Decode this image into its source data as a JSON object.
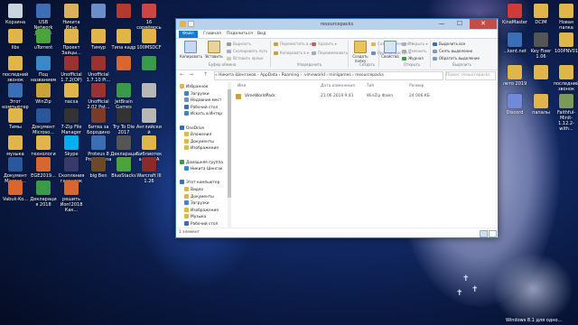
{
  "desktop": {
    "icons": [
      {
        "label": "Корзина",
        "color": "#c9d3dd"
      },
      {
        "label": "USB Network Joystick",
        "color": "#3e6cb5"
      },
      {
        "label": "Никита Илье",
        "color": "#d9b25a"
      },
      {
        "label": "",
        "color": "#6b8fc9"
      },
      {
        "label": "",
        "color": "#b23a2e"
      },
      {
        "label": "16 сорвёмось",
        "color": "#c44"
      },
      {
        "label": "libs",
        "color": "#e0b54a"
      },
      {
        "label": "uTorrent",
        "color": "#4aa33b"
      },
      {
        "label": "Проект Зайцы...",
        "color": "#e0b54a"
      },
      {
        "label": "Тимур",
        "color": "#e0b54a"
      },
      {
        "label": "Типа кадр",
        "color": "#e0b54a"
      },
      {
        "label": "100MSDCF",
        "color": "#e0b54a"
      },
      {
        "label": "последний звонок",
        "color": "#e0b54a"
      },
      {
        "label": "Под названием",
        "color": "#3a88c8"
      },
      {
        "label": "Unofficial 1.7.2(OP)",
        "color": "#9b3232"
      },
      {
        "label": "Unofficial 1.7.10 Pi...",
        "color": "#9b3232"
      },
      {
        "label": "",
        "color": "#d9662e"
      },
      {
        "label": "",
        "color": "#3a9a4a"
      },
      {
        "label": "Этот компьютер",
        "color": "#3a6fb5"
      },
      {
        "label": "WinZip",
        "color": "#c9a33a"
      },
      {
        "label": "пасха",
        "color": "#e0b54a"
      },
      {
        "label": "Unofficial 2.02 Pat...",
        "color": "#9b3232"
      },
      {
        "label": "JetBrain Games",
        "color": "#3a9a4a"
      },
      {
        "label": "",
        "color": "#b7b7b7"
      },
      {
        "label": "Тимы",
        "color": "#e0b54a"
      },
      {
        "label": "Документ Microso...",
        "color": "#2b579a"
      },
      {
        "label": "7-Zip File Manager",
        "color": "#333333"
      },
      {
        "label": "Битва за Бородино",
        "color": "#7a3b2a"
      },
      {
        "label": "Try To Die 2017",
        "color": "#333"
      },
      {
        "label": "Английский",
        "color": "#b7b7b7"
      },
      {
        "label": "музыка",
        "color": "#e0b54a"
      },
      {
        "label": "технология",
        "color": "#e0b54a"
      },
      {
        "label": "Skype",
        "color": "#00aff0"
      },
      {
        "label": "Proteus 8 Professional",
        "color": "#3a6fb5"
      },
      {
        "label": "Декларация 2017",
        "color": "#555"
      },
      {
        "label": "Библиотека АКОЛА",
        "color": "#e0b54a"
      },
      {
        "label": "Документ Microso...",
        "color": "#2b579a"
      },
      {
        "label": "ЕGE2019...",
        "color": "#d9662e"
      },
      {
        "label": "Скопления галактик",
        "color": "#3a3a6a"
      },
      {
        "label": "big Ben",
        "color": "#6a4a2a"
      },
      {
        "label": "BlueStacks",
        "color": "#4aa33b"
      },
      {
        "label": "Warcraft III 1.26",
        "color": "#8a2a2a"
      },
      {
        "label": "Vabuk-Ko...",
        "color": "#d9662e"
      },
      {
        "label": "Декларация 2018",
        "color": "#3a9a4a"
      },
      {
        "label": "решить Иоп!2018 Как...",
        "color": "#d9662e"
      }
    ],
    "right_icons": [
      {
        "label": "KineMaster",
        "color": "#d23a3a"
      },
      {
        "label": "DCIM",
        "color": "#e0b54a"
      },
      {
        "label": "Новая папка",
        "color": "#e0b54a"
      },
      {
        "label": "...kent.net",
        "color": "#3a6fb5"
      },
      {
        "label": "Key Fixer 1.06",
        "color": "#555"
      },
      {
        "label": "100PNV01",
        "color": "#e0b54a"
      },
      {
        "label": "лето 2019",
        "color": "#e0b54a"
      },
      {
        "label": "",
        "color": "#e0b54a"
      },
      {
        "label": "последний звонок",
        "color": "#e0b54a"
      },
      {
        "label": "Discord",
        "color": "#7289da"
      },
      {
        "label": "папалы",
        "color": "#e0b54a"
      },
      {
        "label": "Faithful-Minit-1.12.2-with...",
        "color": "#7a9a5a"
      }
    ],
    "taskbar_hint": "Windows 8.1 для одно..."
  },
  "window": {
    "title": "resourcepacks",
    "controls": {
      "minimize": "—",
      "maximize": "☐",
      "close": "✕"
    },
    "ribbon_tabs": [
      "Файл",
      "Главная",
      "Поделиться",
      "Вид"
    ],
    "ribbon": {
      "copy": "Копировать",
      "paste": "Вставить",
      "cut": "Вырезать",
      "copy_path": "Скопировать путь",
      "paste_shortcut": "Вставить ярлык",
      "group_clipboard": "Буфер обмена",
      "move_to": "Переместить в ▾",
      "copy_to": "Копировать в ▾",
      "delete": "Удалить ▾",
      "rename": "Переименовать",
      "group_organize": "Упорядочить",
      "new_folder": "Создать папку",
      "new_item": "Создать элемент ▾",
      "easy_access": "Простой доступ ▾",
      "group_create": "Создать",
      "properties": "Свойства",
      "open": "Открыть ▾",
      "edit": "Изменить",
      "history": "Журнал",
      "group_open": "Открыть",
      "select_all": "Выделить все",
      "select_none": "Снять выделение",
      "invert_selection": "Обратить выделение",
      "group_select": "Выделить"
    },
    "nav_buttons": {
      "back": "←",
      "forward": "→",
      "up": "↑"
    },
    "address": "« Никита Шенгаков › AppData › Roaming › .vimeworld › minigames › resourcepacks",
    "search_placeholder": "Поиск: resourcepacks",
    "nav_pane": [
      {
        "label": "Избранное",
        "color": "#e0b54a"
      },
      {
        "label": "Загрузки",
        "color": "#3a88c8"
      },
      {
        "label": "Недавние мест",
        "color": "#6a8fc9"
      },
      {
        "label": "Рабочий стол",
        "color": "#3a6fb5"
      },
      {
        "label": "Искать в Интер",
        "color": "#3a88c8"
      },
      {
        "label": "",
        "color": "transparent"
      },
      {
        "label": "OneDrive",
        "color": "#2b6fc9"
      },
      {
        "label": "Вложения",
        "color": "#e0b54a"
      },
      {
        "label": "Документы",
        "color": "#e0b54a"
      },
      {
        "label": "Изображения",
        "color": "#e0b54a"
      },
      {
        "label": "",
        "color": "transparent"
      },
      {
        "label": "Домашняя группа",
        "color": "#3a9a4a"
      },
      {
        "label": "Никита Шенгак",
        "color": "#3a88c8"
      },
      {
        "label": "",
        "color": "transparent"
      },
      {
        "label": "Этот компьютер",
        "color": "#3a6fb5"
      },
      {
        "label": "Видео",
        "color": "#e0b54a"
      },
      {
        "label": "Документы",
        "color": "#e0b54a"
      },
      {
        "label": "Загрузки",
        "color": "#3a88c8"
      },
      {
        "label": "Изображения",
        "color": "#e0b54a"
      },
      {
        "label": "Музыка",
        "color": "#e0b54a"
      },
      {
        "label": "Рабочий стол",
        "color": "#3a6fb5"
      }
    ],
    "columns": {
      "name": "Имя",
      "date": "Дата изменения",
      "type": "Тип",
      "size": "Размер"
    },
    "files": [
      {
        "name": "VimeWorldPack",
        "date": "21.06.2019 9:41",
        "type": "WinZip Файл",
        "size": "24 006 КБ"
      }
    ],
    "status": "1 элемент"
  }
}
